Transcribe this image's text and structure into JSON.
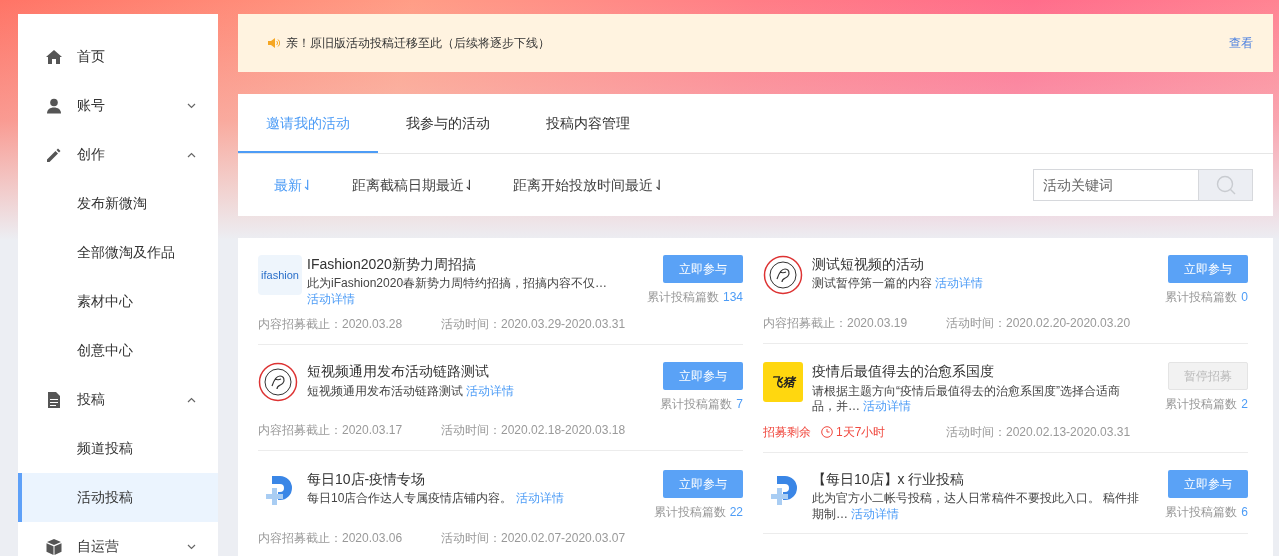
{
  "sidebar": {
    "items": [
      {
        "label": "首页",
        "selected": false
      },
      {
        "label": "账号",
        "selected": false,
        "expanded": false
      },
      {
        "label": "创作",
        "selected": false,
        "expanded": true,
        "children": [
          {
            "label": "发布新微淘",
            "selected": false
          },
          {
            "label": "全部微淘及作品",
            "selected": false
          },
          {
            "label": "素材中心",
            "selected": false
          },
          {
            "label": "创意中心",
            "selected": false
          }
        ]
      },
      {
        "label": "投稿",
        "selected": false,
        "expanded": true,
        "children": [
          {
            "label": "频道投稿",
            "selected": false
          },
          {
            "label": "活动投稿",
            "selected": true
          }
        ]
      },
      {
        "label": "自运营",
        "selected": false,
        "expanded": false
      }
    ]
  },
  "notice": {
    "text": "亲！原旧版活动投稿迁移至此（后续将逐步下线）",
    "link": "查看"
  },
  "tabs": [
    {
      "label": "邀请我的活动",
      "selected": true
    },
    {
      "label": "我参与的活动",
      "selected": false
    },
    {
      "label": "投稿内容管理",
      "selected": false
    }
  ],
  "sort_options": [
    {
      "label": "最新",
      "arrow": "⇃",
      "selected": true
    },
    {
      "label": "距离截稿日期最近",
      "arrow": "⇃",
      "selected": false
    },
    {
      "label": "距离开始投放时间最近",
      "arrow": "⇃",
      "selected": false
    }
  ],
  "search": {
    "placeholder": "活动关键词"
  },
  "activities": [
    {
      "kind": "textlogo",
      "logo_text": "ifashion",
      "title": "IFashion2020新势力周招搞",
      "description": "此为iFashion2020春新势力周特约招搞，招搞内容不仅…",
      "detail_link": "活动详情",
      "button": "立即参与",
      "disabled": false,
      "count_label": "累计投稿篇数",
      "count": "134",
      "urgent": false,
      "deadline_label": "内容招募截止：",
      "deadline": "2020.03.28",
      "period_label": "活动时间：",
      "period": "2020.03.29-2020.03.31"
    },
    {
      "kind": "crest",
      "title": "测试短视频的活动",
      "description": "测试暂停第一篇的内容",
      "detail_link": "活动详情",
      "button": "立即参与",
      "disabled": false,
      "count_label": "累计投稿篇数",
      "count": "0",
      "urgent": false,
      "deadline_label": "内容招募截止：",
      "deadline": "2020.03.19",
      "period_label": "活动时间：",
      "period": "2020.02.20-2020.03.20"
    },
    {
      "kind": "crest",
      "title": "短视频通用发布活动链路测试",
      "description": "短视频通用发布活动链路测试",
      "detail_link": "活动详情",
      "button": "立即参与",
      "disabled": false,
      "count_label": "累计投稿篇数",
      "count": "7",
      "urgent": false,
      "deadline_label": "内容招募截止：",
      "deadline": "2020.03.17",
      "period_label": "活动时间：",
      "period": "2020.02.18-2020.03.18"
    },
    {
      "kind": "badgelogo",
      "logo_text": "飞猪",
      "title": "疫情后最值得去的治愈系国度",
      "description": "请根据主题方向“疫情后最值得去的治愈系国度”选择合适商品，并…",
      "detail_link": "活动详情",
      "button": "暂停招募",
      "disabled": true,
      "count_label": "累计投稿篇数",
      "count": "2",
      "urgent": true,
      "deadline_label": "招募剩余",
      "deadline": "1天7小时",
      "period_label": "活动时间：",
      "period": "2020.02.13-2020.03.31"
    },
    {
      "kind": "plus",
      "title": "每日10店-疫情专场",
      "description": "每日10店合作达人专属疫情店铺内容。",
      "detail_link": "活动详情",
      "button": "立即参与",
      "disabled": false,
      "count_label": "累计投稿篇数",
      "count": "22",
      "urgent": false,
      "deadline_label": "内容招募截止：",
      "deadline": "2020.03.06",
      "period_label": "活动时间：",
      "period": "2020.02.07-2020.03.07"
    },
    {
      "kind": "plus",
      "title": "【每日10店】x 行业投稿",
      "description": "此为官方小二帐号投稿，达人日常稿件不要投此入口。 稿件排期制…",
      "detail_link": "活动详情",
      "button": "立即参与",
      "disabled": false,
      "count_label": "累计投稿篇数",
      "count": "6"
    }
  ]
}
